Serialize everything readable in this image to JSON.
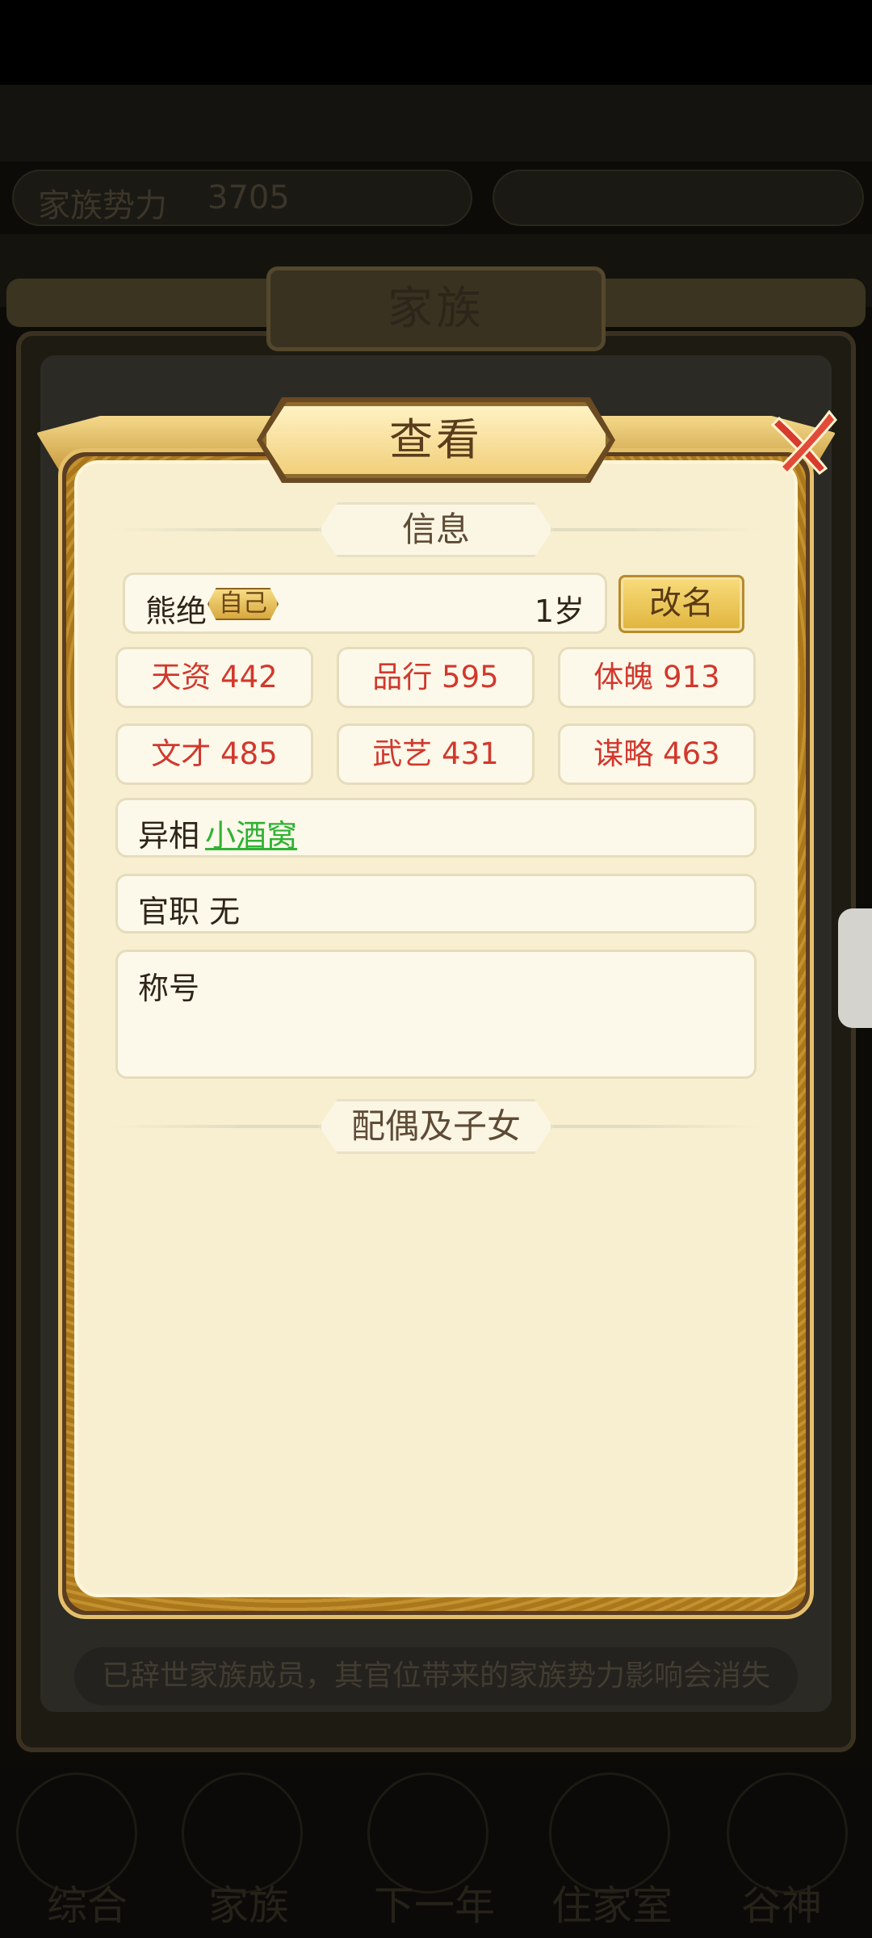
{
  "background": {
    "top_bar": {
      "label": "家族势力",
      "value": "3705"
    },
    "panel_title": "家族",
    "notice": "已辞世家族成员，其官位带来的家族势力影响会消失",
    "nav": [
      "综合",
      "家族",
      "下一年",
      "住家室",
      "谷神"
    ]
  },
  "dialog": {
    "title": "查看",
    "info_header": "信息",
    "name": "熊绝",
    "self_badge": "自己",
    "age": "1岁",
    "rename_label": "改名",
    "stats": [
      {
        "label": "天资 442"
      },
      {
        "label": "品行 595"
      },
      {
        "label": "体魄 913"
      },
      {
        "label": "文才 485"
      },
      {
        "label": "武艺 431"
      },
      {
        "label": "谋略 463"
      }
    ],
    "trait_label": "异相",
    "trait_value": "小酒窝",
    "office": "官职 无",
    "title_label": "称号",
    "family_header": "配偶及子女"
  },
  "colors": {
    "stat_text": "#d2382d",
    "trait_link": "#2fb234",
    "dialog_bg": "#f7efcf",
    "gold": "#e0b43c"
  }
}
